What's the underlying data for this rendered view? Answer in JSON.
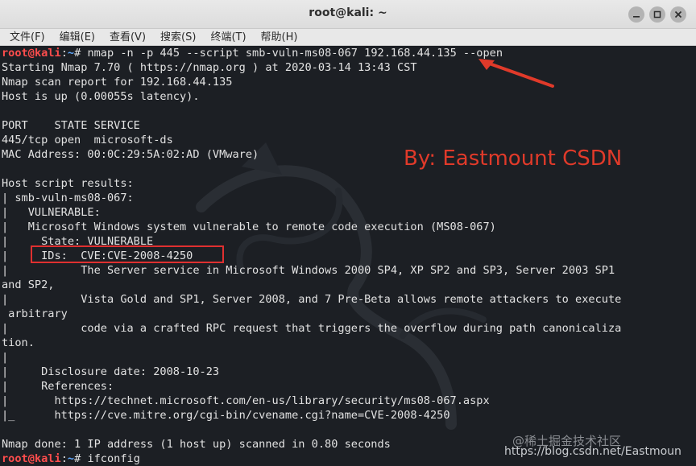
{
  "window": {
    "title": "root@kali: ~",
    "buttons": [
      "minimize-icon",
      "maximize-icon",
      "close-icon"
    ]
  },
  "menu": [
    "文件(F)",
    "编辑(E)",
    "查看(V)",
    "搜索(S)",
    "终端(T)",
    "帮助(H)"
  ],
  "prompt": {
    "user": "root",
    "at": "@",
    "host": "kali",
    "colon": ":",
    "path": "~",
    "sign": "# "
  },
  "commands": {
    "first": "nmap -n -p 445 --script smb-vuln-ms08-067 192.168.44.135 --open",
    "last": "ifconfig"
  },
  "output": [
    "Starting Nmap 7.70 ( https://nmap.org ) at 2020-03-14 13:43 CST",
    "Nmap scan report for 192.168.44.135",
    "Host is up (0.00055s latency).",
    "",
    "PORT    STATE SERVICE",
    "445/tcp open  microsoft-ds",
    "MAC Address: 00:0C:29:5A:02:AD (VMware)",
    "",
    "Host script results:",
    "| smb-vuln-ms08-067:",
    "|   VULNERABLE:",
    "|   Microsoft Windows system vulnerable to remote code execution (MS08-067)",
    "|     State: VULNERABLE",
    "|     IDs:  CVE:CVE-2008-4250",
    "|           The Server service in Microsoft Windows 2000 SP4, XP SP2 and SP3, Server 2003 SP1",
    "and SP2,",
    "|           Vista Gold and SP1, Server 2008, and 7 Pre-Beta allows remote attackers to execute",
    " arbitrary",
    "|           code via a crafted RPC request that triggers the overflow during path canonicaliza",
    "tion.",
    "|",
    "|     Disclosure date: 2008-10-23",
    "|     References:",
    "|       https://technet.microsoft.com/en-us/library/security/ms08-067.aspx",
    "|_      https://cve.mitre.org/cgi-bin/cvename.cgi?name=CVE-2008-4250",
    "",
    "Nmap done: 1 IP address (1 host up) scanned in 0.80 seconds"
  ],
  "overlays": {
    "byline": "By:  Eastmount CSDN",
    "watermark": "@稀土掘金技术社区",
    "watermark_url": "https://blog.csdn.net/Eastmoun"
  },
  "colors": {
    "terminal_bg": "#1c1f24",
    "text": "#e2e2e2",
    "prompt_user": "#ff4d4d",
    "prompt_path": "#5fa8ff",
    "annotation_red": "#e03030"
  }
}
